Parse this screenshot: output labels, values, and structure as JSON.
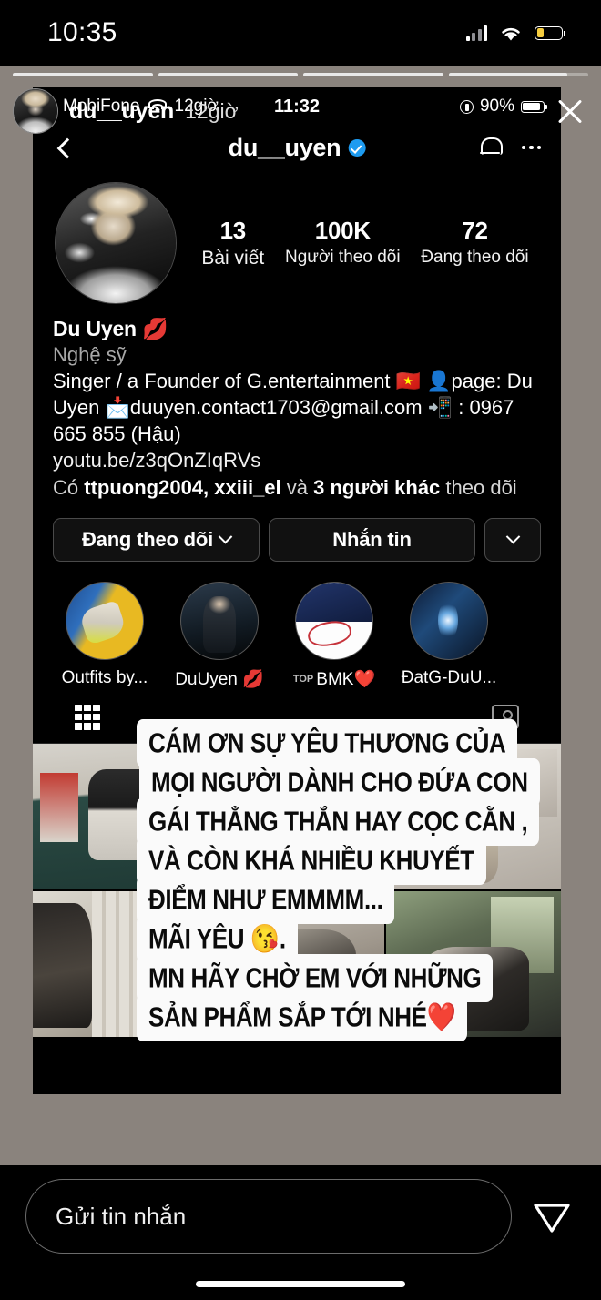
{
  "phone_status": {
    "clock": "10:35",
    "battery_percent_fill": "28%",
    "icons": [
      "signal-bars",
      "wifi",
      "battery-low-power"
    ]
  },
  "story": {
    "username": "du__uyen",
    "timestamp": "12giờ",
    "progress_segments": [
      100,
      100,
      100,
      85
    ],
    "close_label": "X"
  },
  "inner_screenshot": {
    "ios_status": {
      "carrier": "MobiFone",
      "hours_label": "12giờ",
      "clock": "11:32",
      "battery_text": "90%"
    },
    "profile_nav": {
      "title": "du__uyen",
      "verified": true,
      "back_icon": "chevron-left-icon",
      "bell_icon": "bell-icon",
      "more_icon": "more-options-icon"
    },
    "stats": [
      {
        "num": "13",
        "label": "Bài viết"
      },
      {
        "num": "100K",
        "label": "Người theo dõi"
      },
      {
        "num": "72",
        "label": "Đang theo dõi"
      }
    ],
    "bio": {
      "name": "Du Uyen 💋",
      "category": "Nghệ sỹ",
      "text": "Singer / a Founder of G.entertainment 🇻🇳 👤page: Du Uyen 📩duuyen.contact1703@gmail.com 📲 : 0967 665 855 (Hậu)",
      "link": "youtu.be/z3qOnZIqRVs",
      "followed_by_prefix": "Có ",
      "followed_by_names": "ttpuong2004, xxiii_el",
      "followed_by_mid": " và ",
      "followed_by_others": "3 người khác",
      "followed_by_suffix": " theo dõi"
    },
    "buttons": {
      "following": "Đang theo dõi",
      "message": "Nhắn tin",
      "more": "chevron-down-icon"
    },
    "highlights": [
      {
        "label": "Outfits by..."
      },
      {
        "label": "DuUyen 💋"
      },
      {
        "label": "BMK❤️",
        "badge": "TOP"
      },
      {
        "label": "ĐatG-DuU..."
      }
    ],
    "tabs": {
      "grid": "grid-icon",
      "tagged": "tagged-icon"
    }
  },
  "caption_lines": [
    "CÁM ƠN SỰ YÊU THƯƠNG CỦA",
    "MỌI NGƯỜI DÀNH CHO ĐỨA CON",
    "GÁI THẲNG THẮN HAY CỌC CẰN ,",
    "VÀ CÒN KHÁ NHIỀU KHUYẾT",
    "ĐIỂM NHƯ EMMMM...",
    "MÃI YÊU 😘.",
    "MN HÃY CHỜ EM VỚI NHỮNG",
    "SẢN PHẨM SẮP TỚI NHÉ❤️"
  ],
  "reply": {
    "placeholder": "Gửi tin nhắn",
    "send_icon": "send-paper-plane-icon"
  },
  "colors": {
    "verified_blue": "#1d9bf0",
    "story_bg": "#8a837d",
    "caption_bg": "#fafafa",
    "battery_yellow": "#f5cc3f"
  }
}
